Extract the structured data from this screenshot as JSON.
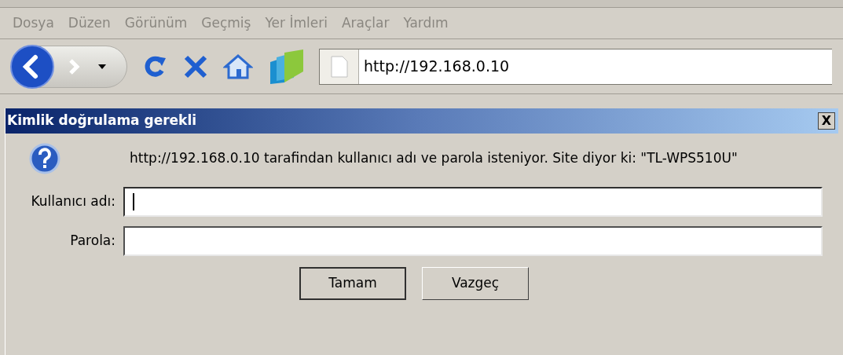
{
  "menu": [
    {
      "label": "Dosya",
      "disabled": true
    },
    {
      "label": "Düzen",
      "disabled": true
    },
    {
      "label": "Görünüm",
      "disabled": true
    },
    {
      "label": "Geçmiş",
      "disabled": true
    },
    {
      "label": "Yer İmleri",
      "disabled": true
    },
    {
      "label": "Araçlar",
      "disabled": true
    },
    {
      "label": "Yardım",
      "disabled": true
    }
  ],
  "address_bar": {
    "value": "http://192.168.0.10"
  },
  "dialog": {
    "title": "Kimlik doğrulama gerekli",
    "close": "X",
    "message": "http://192.168.0.10 tarafindan kullanıcı adı ve parola isteniyor. Site diyor ki: \"TL-WPS510U\"",
    "fields": [
      {
        "label": "Kullanıcı adı:",
        "focused": true
      },
      {
        "label": "Parola:",
        "focused": false
      }
    ],
    "buttons": [
      {
        "label": "Tamam",
        "default": true
      },
      {
        "label": "Vazgeç",
        "default": false
      }
    ]
  }
}
